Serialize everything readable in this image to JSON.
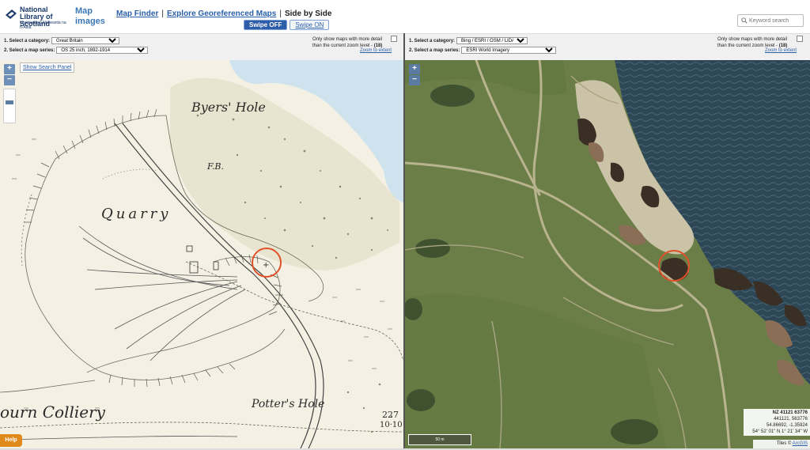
{
  "header": {
    "logo_title": "National Library of Scotland",
    "logo_subtitle": "Leabharlann Nàiseanta na h-Alba",
    "app_name": "Map images",
    "nav": {
      "map_finder": "Map Finder",
      "separator": "|",
      "explore_georef": "Explore Georeferenced Maps",
      "side_by_side": "Side by Side"
    },
    "swipe_off": "Swipe OFF",
    "swipe_on": "Swipe ON",
    "search_placeholder": "Keyword search"
  },
  "left_panel": {
    "category_label": "1. Select a category:",
    "category_value": "Great Britain",
    "series_label": "2. Select a map series:",
    "series_value": "OS 25 inch, 1892-1914",
    "detail_note_line1": "Only show maps with more detail",
    "detail_note_line2": "than the current zoom level - ",
    "zoom_level": "(18)",
    "zoom_extent": "Zoom to extent",
    "show_search_panel": "Show Search Panel",
    "zoom_in": "+",
    "zoom_out": "−",
    "help": "Help",
    "map_labels": {
      "byers_hole": "Byers' Hole",
      "fb": "F.B.",
      "quarry": "Quarry",
      "colliery": "ourn Colliery",
      "potters_hole": "Potter's Hole",
      "num_227": "227",
      "num_1010": "10·10"
    }
  },
  "right_panel": {
    "category_label": "1. Select a category:",
    "category_value": "Bing / ESRI / OSM / LIDAR",
    "series_label": "2. Select a map series:",
    "series_value": "ESRI World Imagery",
    "detail_note_line1": "Only show maps with more detail",
    "detail_note_line2": "than the current zoom level - ",
    "zoom_level": "(18)",
    "zoom_extent": "Zoom to extent",
    "zoom_in": "+",
    "zoom_out": "−",
    "scale": "50 m",
    "coords": {
      "grid_ref": "NZ 41121 63776",
      "easting_northing": "441121, 563776",
      "latlon_dec": "54.86692, -1.35924",
      "latlon_dms": "54° 52' 01\" N 1° 21' 34\" W"
    },
    "tiles_label": "Tiles © ",
    "tiles_link": "ArcGIS"
  },
  "colors": {
    "accent": "#2d5ca8",
    "help": "#e08a1b",
    "highlight_circle": "#e0502a",
    "sea": "#2f4a5a",
    "grass": "#677a45"
  }
}
